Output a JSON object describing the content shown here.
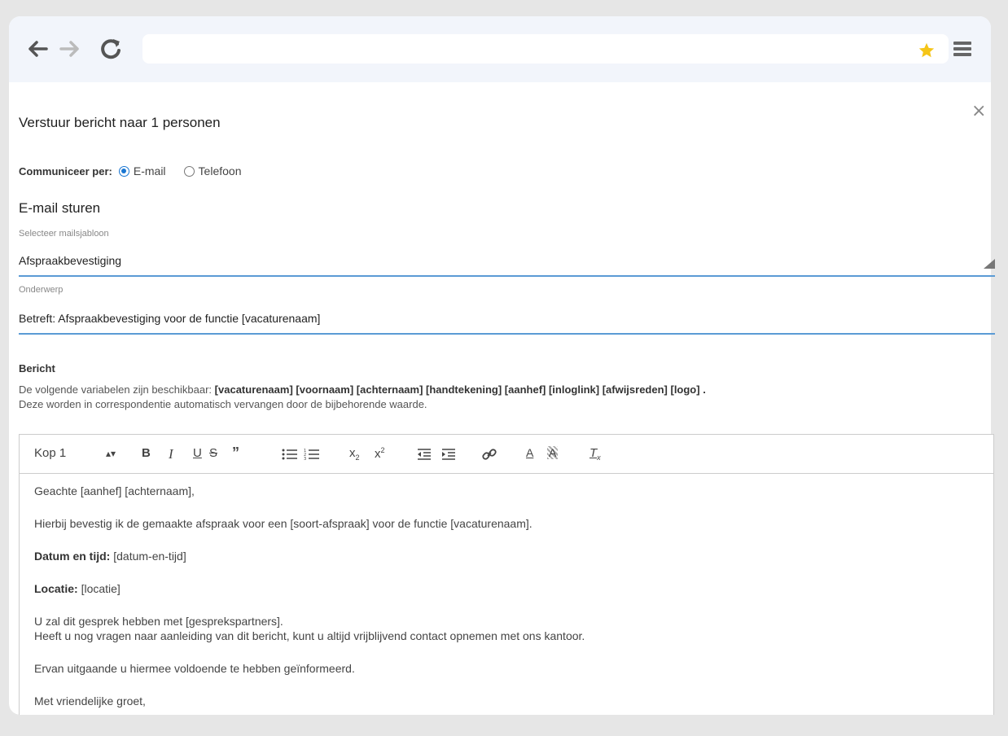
{
  "browser": {
    "url": "",
    "star_color": "#f5c518"
  },
  "dialog": {
    "title": "Verstuur bericht naar 1 personen",
    "close_glyph": "×"
  },
  "communicate": {
    "label": "Communiceer per:",
    "options": [
      {
        "label": "E-mail",
        "selected": true
      },
      {
        "label": "Telefoon",
        "selected": false
      }
    ]
  },
  "email_section": {
    "title": "E-mail sturen",
    "template_label": "Selecteer mailsjabloon",
    "template_value": "Afspraakbevestiging",
    "subject_label": "Onderwerp",
    "subject_value": "Betreft: Afspraakbevestiging voor de functie [vacaturenaam]"
  },
  "message": {
    "label": "Bericht",
    "vars_intro": "De volgende variabelen zijn beschikbaar:",
    "vars_list": "[vacaturenaam] [voornaam] [achternaam] [handtekening] [aanhef] [inloglink] [afwijsreden] [logo] .",
    "vars_note": "Deze worden in correspondentie automatisch vervangen door de bijbehorende waarde."
  },
  "editor": {
    "heading_select": "Kop 1",
    "toolbar_icons": [
      "select-arrows-icon",
      "bold-icon",
      "italic-icon",
      "underline-icon",
      "strikethrough-icon",
      "quote-icon",
      "bullet-list-icon",
      "numbered-list-icon",
      "subscript-icon",
      "superscript-icon",
      "outdent-icon",
      "indent-icon",
      "link-icon",
      "font-color-icon",
      "background-color-icon",
      "clear-format-icon"
    ],
    "body": {
      "line1": "Geachte [aanhef] [achternaam],",
      "line2": "Hierbij bevestig ik de gemaakte afspraak voor een [soort-afspraak] voor de functie [vacaturenaam].",
      "datetime_label": "Datum en tijd:",
      "datetime_value": " [datum-en-tijd]",
      "location_label": "Locatie:",
      "location_value": " [locatie]",
      "line5a": "U zal dit gesprek hebben met [gesprekspartners].",
      "line5b": "Heeft u nog vragen naar aanleiding van dit bericht, kunt u altijd vrijblijvend contact opnemen met ons kantoor.",
      "line6": "Ervan uitgaande u hiermee voldoende te hebben geïnformeerd.",
      "line7": "Met vriendelijke groet,"
    }
  }
}
